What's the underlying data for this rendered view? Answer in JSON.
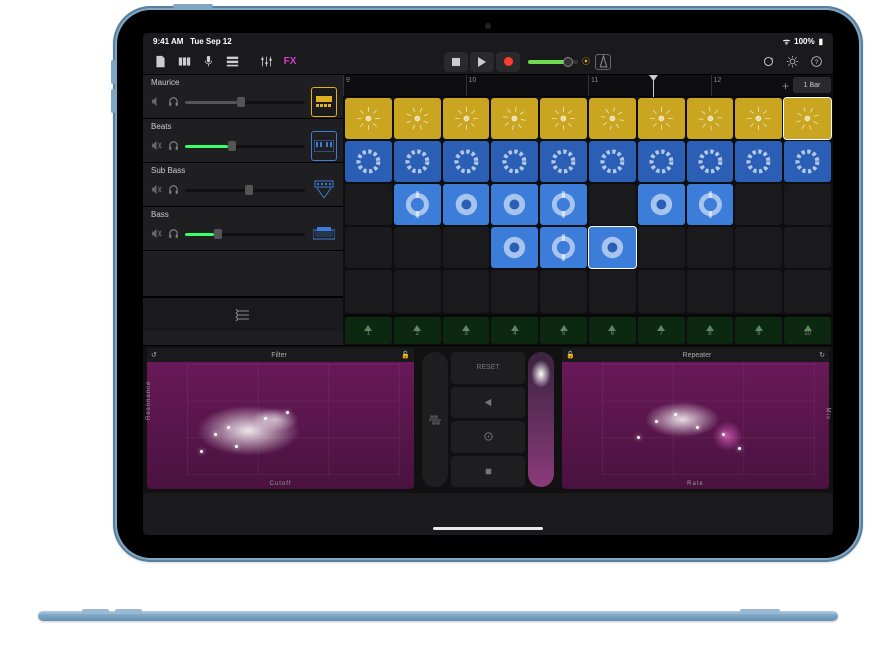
{
  "status": {
    "time": "9:41 AM",
    "date": "Tue Sep 12",
    "battery": "100%",
    "wifi": "●●●"
  },
  "toolbar": {
    "fx_label": "FX"
  },
  "ruler": {
    "ticks": [
      "9",
      "10",
      "11",
      "12"
    ],
    "bar_label": "1 Bar"
  },
  "tracks": [
    {
      "name": "Maurice",
      "color": "#e0b020",
      "mute": false,
      "slider": 0.43,
      "instrument": "drum-machine"
    },
    {
      "name": "Beats",
      "color": "#3b7dd8",
      "mute": true,
      "slider": 0.36,
      "fill_color": "#39ff6a",
      "instrument": "keyboard"
    },
    {
      "name": "Sub Bass",
      "color": "#3b7dd8",
      "mute": true,
      "slider": 0.5,
      "instrument": "synth-stand"
    },
    {
      "name": "Bass",
      "color": "#3b7dd8",
      "mute": true,
      "slider": 0.24,
      "fill_color": "#39ff6a",
      "instrument": "synth"
    }
  ],
  "cell_grid": {
    "columns": 10,
    "column_labels": [
      "1",
      "2",
      "3",
      "4",
      "5",
      "6",
      "7",
      "8",
      "9",
      "10"
    ],
    "rows": [
      {
        "style": "yellow",
        "pattern": "burst",
        "filled": [
          0,
          1,
          2,
          3,
          4,
          5,
          6,
          7,
          8,
          9
        ],
        "playing": 9
      },
      {
        "style": "blue",
        "pattern": "ring",
        "filled": [
          0,
          1,
          2,
          3,
          4,
          5,
          6,
          7,
          8,
          9
        ],
        "playing": null
      },
      {
        "style": "blue2",
        "pattern": "disk",
        "filled": [
          1,
          2,
          3,
          4,
          6,
          7
        ],
        "playing": null
      },
      {
        "style": "blue2",
        "pattern": "disk",
        "filled": [
          3,
          4,
          5
        ],
        "playing": 5
      },
      {
        "style": "empty",
        "pattern": "none",
        "filled": [],
        "playing": null
      }
    ]
  },
  "fx": {
    "left": {
      "title": "Filter",
      "x_axis": "Cutoff",
      "y_axis": "Resonance"
    },
    "right": {
      "title": "Repeater",
      "x_axis": "Rate",
      "y_axis": "Mix"
    },
    "mid": {
      "reset_label": "RESET"
    }
  }
}
